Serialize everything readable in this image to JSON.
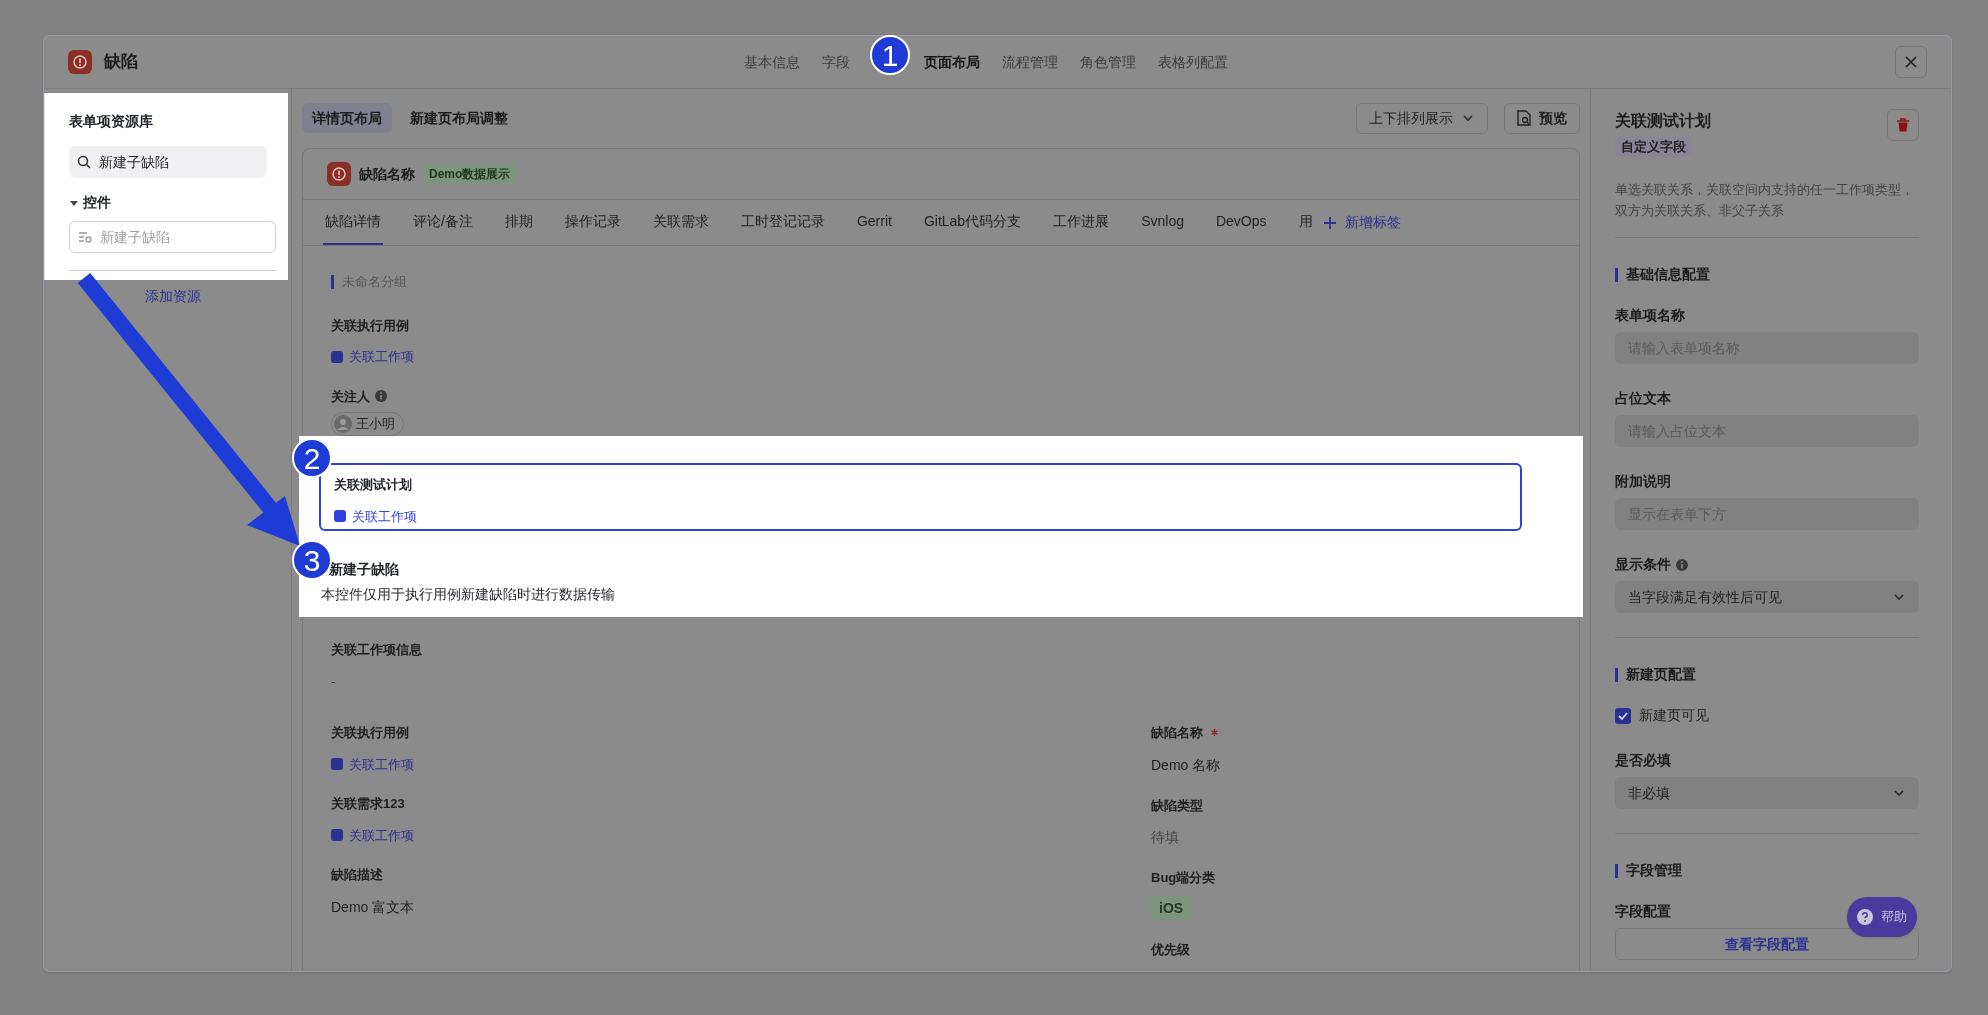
{
  "header": {
    "title": "缺陷",
    "nav": [
      {
        "label": "基本信息",
        "selected": false
      },
      {
        "label": "字段",
        "selected": false
      },
      {
        "label": "页面布局",
        "selected": true
      },
      {
        "label": "流程管理",
        "selected": false
      },
      {
        "label": "角色管理",
        "selected": false
      },
      {
        "label": "表格列配置",
        "selected": false
      }
    ]
  },
  "markers": [
    "1",
    "2",
    "3"
  ],
  "resource_panel": {
    "title": "表单项资源库",
    "search": "新建子缺陷",
    "group": {
      "label": "控件",
      "expanded": true
    },
    "item_placeholder": "新建子缺陷",
    "add_link": "添加资源"
  },
  "layout_tabs": [
    {
      "label": "详情页布局",
      "selected": true
    },
    {
      "label": "新建页布局调整",
      "selected": false
    }
  ],
  "arrange_dropdown": "上下排列展示",
  "preview_button": "预览",
  "card": {
    "title": "缺陷名称",
    "badge": "Demo数据展示",
    "tabs": [
      {
        "label": "缺陷详情",
        "selected": true
      },
      {
        "label": "评论/备注",
        "selected": false
      },
      {
        "label": "排期",
        "selected": false
      },
      {
        "label": "操作记录",
        "selected": false
      },
      {
        "label": "关联需求",
        "selected": false
      },
      {
        "label": "工时登记记录",
        "selected": false
      },
      {
        "label": "Gerrit",
        "selected": false
      },
      {
        "label": "GitLab代码分支",
        "selected": false
      },
      {
        "label": "工作进展",
        "selected": false
      },
      {
        "label": "Svnlog",
        "selected": false
      },
      {
        "label": "DevOps",
        "selected": false
      },
      {
        "label": "用",
        "selected": false
      }
    ],
    "add_tab": "新增标签",
    "group_title": "未命名分组",
    "fields_top": [
      {
        "kind": "link",
        "label": "关联执行用例",
        "info": false,
        "value": "关联工作项"
      },
      {
        "kind": "user",
        "label": "关注人",
        "info": true,
        "value": "王小明"
      }
    ],
    "selected_field": {
      "label": "关联测试计划",
      "value": "关联工作项"
    },
    "new_field": {
      "label": "新建子缺陷",
      "description": "本控件仅用于执行用例新建缺陷时进行数据传输"
    },
    "info_field": {
      "label": "关联工作项信息",
      "value": "-"
    },
    "left_fields": [
      {
        "kind": "link",
        "label": "关联执行用例",
        "value": "关联工作项"
      },
      {
        "kind": "link",
        "label": "关联需求123",
        "value": "关联工作项"
      },
      {
        "kind": "text",
        "label": "缺陷描述",
        "value": "Demo 富文本"
      }
    ],
    "right_fields": [
      {
        "kind": "text",
        "label": "缺陷名称",
        "required": true,
        "value": "Demo 名称"
      },
      {
        "kind": "placeholder",
        "label": "缺陷类型",
        "required": false,
        "value": "待填"
      },
      {
        "kind": "tag",
        "label": "Bug端分类",
        "required": false,
        "value": "iOS"
      },
      {
        "kind": "empty",
        "label": "优先级",
        "required": false
      }
    ]
  },
  "right_panel": {
    "title": "关联测试计划",
    "tag": "自定义字段",
    "description": "单选关联关系，关联空间内支持的任一工作项类型，双方为关联关系、非父子关系",
    "sections": [
      {
        "title": "基础信息配置",
        "items": [
          {
            "kind": "input",
            "label": "表单项名称",
            "info": false,
            "placeholder": "请输入表单项名称"
          },
          {
            "kind": "input",
            "label": "占位文本",
            "info": false,
            "placeholder": "请输入占位文本"
          },
          {
            "kind": "input",
            "label": "附加说明",
            "info": false,
            "placeholder": "显示在表单下方"
          },
          {
            "kind": "select",
            "label": "显示条件",
            "info": true,
            "value": "当字段满足有效性后可见"
          }
        ]
      },
      {
        "title": "新建页配置",
        "items": [
          {
            "kind": "checkbox",
            "label": "新建页可见",
            "checked": true
          },
          {
            "kind": "select",
            "label": "是否必填",
            "info": false,
            "value": "非必填"
          }
        ]
      },
      {
        "title": "字段管理",
        "items": [
          {
            "kind": "button",
            "label": "字段配置",
            "info": false,
            "button": "查看字段配置"
          }
        ]
      }
    ]
  },
  "help_button": "帮助"
}
